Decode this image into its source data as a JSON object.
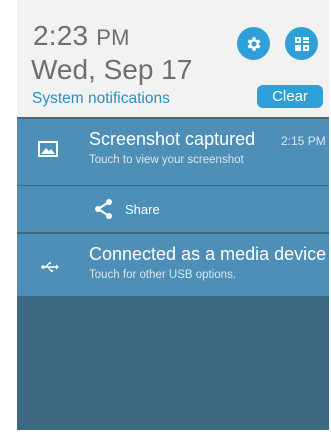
{
  "header": {
    "time": "2:23",
    "ampm": "PM",
    "date": "Wed, Sep 17",
    "system_notifications_label": "System notifications",
    "clear_label": "Clear",
    "settings_icon": "gear-icon",
    "quick_settings_icon": "quick-settings-icon"
  },
  "notifications": [
    {
      "icon": "image-icon",
      "title": "Screenshot captured",
      "subtitle": "Touch to view your screenshot",
      "time": "2:15 PM",
      "action": {
        "icon": "share-icon",
        "label": "Share"
      }
    },
    {
      "icon": "usb-icon",
      "title": "Connected as a media device",
      "subtitle": "Touch for other USB options."
    }
  ],
  "colors": {
    "accent": "#2f9fd8",
    "notification_bg": "#4e8fb8",
    "shade_bg": "#3d6a82",
    "header_bg": "#f2f2f2"
  }
}
